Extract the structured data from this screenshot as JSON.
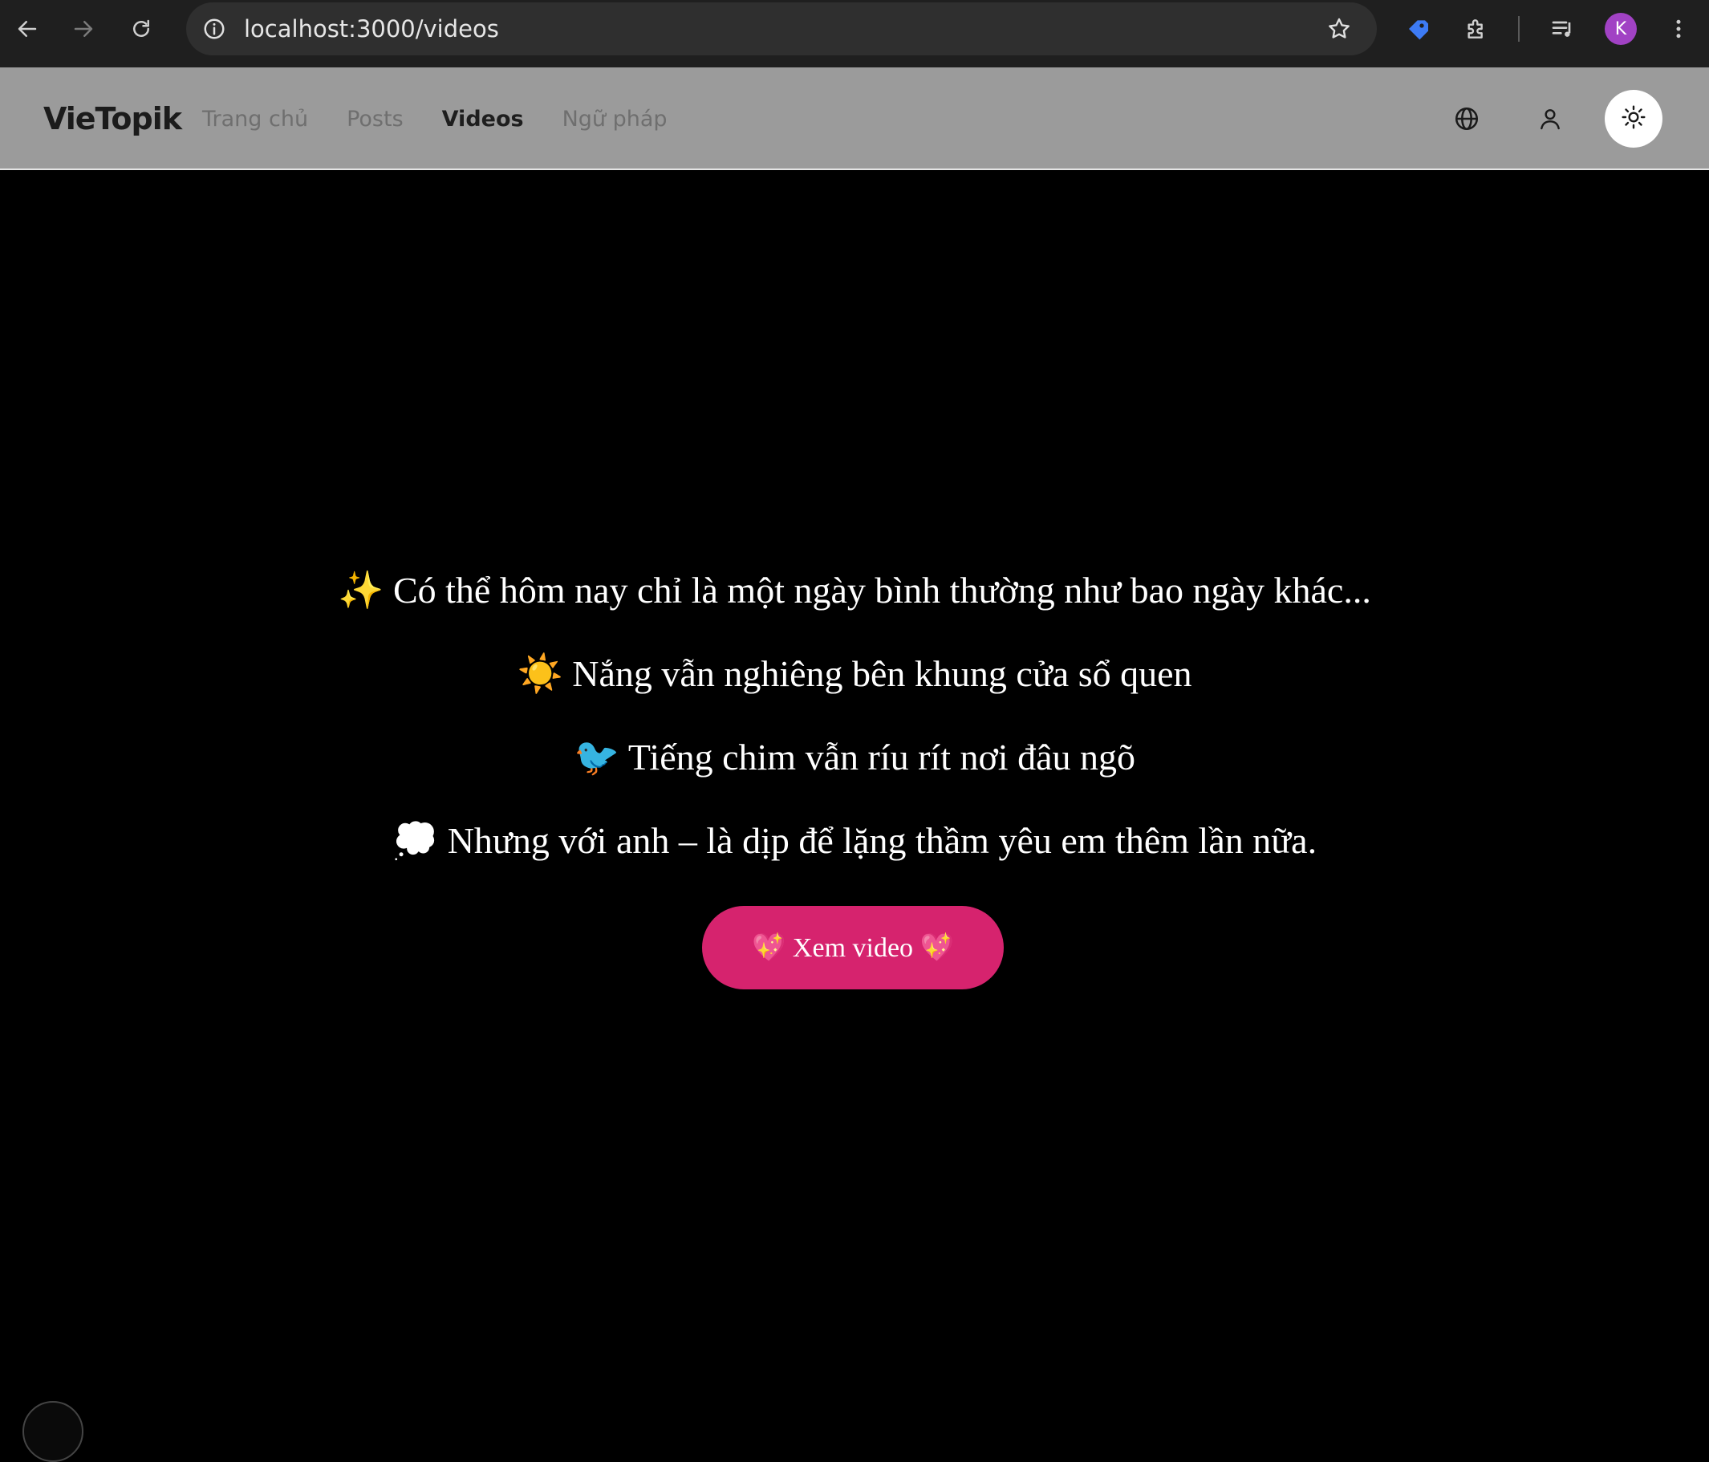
{
  "browser": {
    "url": "localhost:3000/videos",
    "profile_initial": "K",
    "profile_color": "#a142c4"
  },
  "header": {
    "brand": "VieTopik",
    "nav": [
      {
        "label": "Trang chủ",
        "active": false
      },
      {
        "label": "Posts",
        "active": false
      },
      {
        "label": "Videos",
        "active": true
      },
      {
        "label": "Ngữ pháp",
        "active": false
      }
    ],
    "icons": [
      "globe-icon",
      "user-icon",
      "sun-icon"
    ]
  },
  "main": {
    "lines": [
      "✨ Có thể hôm nay chỉ là một ngày bình thường như bao ngày khác...",
      "☀️ Nắng vẫn nghiêng bên khung cửa sổ quen",
      "🐦 Tiếng chim vẫn ríu rít nơi đâu ngõ",
      "💭 Nhưng với anh – là dịp để lặng thầm yêu em thêm lần nữa."
    ],
    "button_label": "💖 Xem video 💖",
    "button_color": "#d6236e"
  }
}
